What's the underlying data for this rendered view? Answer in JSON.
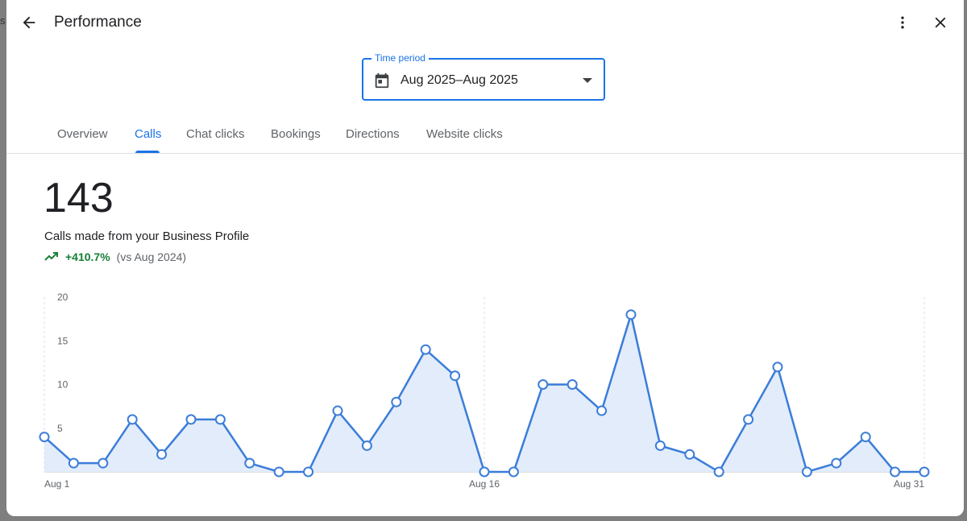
{
  "header": {
    "title": "Performance"
  },
  "time_period": {
    "label": "Time period",
    "value": "Aug 2025–Aug 2025"
  },
  "tabs": [
    {
      "label": "Overview",
      "active": false
    },
    {
      "label": "Calls",
      "active": true
    },
    {
      "label": "Chat clicks",
      "active": false
    },
    {
      "label": "Bookings",
      "active": false
    },
    {
      "label": "Directions",
      "active": false
    },
    {
      "label": "Website clicks",
      "active": false
    }
  ],
  "summary": {
    "total": "143",
    "description": "Calls made from your Business Profile",
    "change": "+410.7%",
    "comparison": "(vs Aug 2024)"
  },
  "colors": {
    "accent": "#1a73e8",
    "positive": "#188038",
    "line": "#3b7dd8",
    "fill": "#e2ecfb"
  },
  "chart_data": {
    "type": "area",
    "x": [
      "Aug 1",
      "Aug 2",
      "Aug 3",
      "Aug 4",
      "Aug 5",
      "Aug 6",
      "Aug 7",
      "Aug 8",
      "Aug 9",
      "Aug 10",
      "Aug 11",
      "Aug 12",
      "Aug 13",
      "Aug 14",
      "Aug 15",
      "Aug 16",
      "Aug 17",
      "Aug 18",
      "Aug 19",
      "Aug 20",
      "Aug 21",
      "Aug 22",
      "Aug 23",
      "Aug 24",
      "Aug 25",
      "Aug 26",
      "Aug 27",
      "Aug 28",
      "Aug 29",
      "Aug 30",
      "Aug 31"
    ],
    "x_tick_labels": [
      "Aug 1",
      "Aug 16",
      "Aug 31"
    ],
    "series": [
      {
        "values": [
          4,
          1,
          1,
          6,
          2,
          6,
          6,
          1,
          0,
          0,
          7,
          3,
          8,
          14,
          11,
          0,
          0,
          10,
          10,
          7,
          18,
          3,
          2,
          0,
          6,
          12,
          0,
          1,
          4,
          0,
          0
        ]
      }
    ],
    "y_ticks": [
      5,
      10,
      15,
      20
    ],
    "ylim": [
      0,
      20
    ],
    "grid": "vertical dashed"
  }
}
